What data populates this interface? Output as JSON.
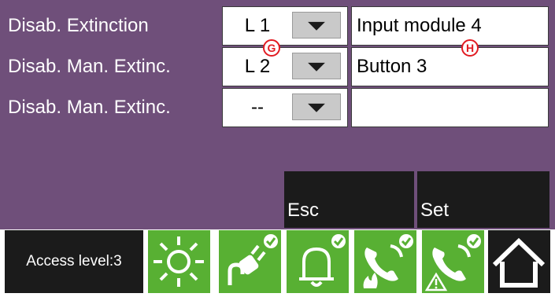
{
  "rows": [
    {
      "label": "Disab. Extinction",
      "level": "L 1",
      "device": "Input module 4"
    },
    {
      "label": "Disab. Man. Extinc.",
      "level": "L 2",
      "device": "Button 3"
    },
    {
      "label": "Disab. Man. Extinc.",
      "level": "--",
      "device": ""
    }
  ],
  "markers": {
    "g": "G",
    "h": "H"
  },
  "actions": {
    "esc": "Esc",
    "set": "Set"
  },
  "access_level": "Access level:3",
  "status_icons": [
    "sun-icon",
    "power-plug-icon",
    "bell-icon",
    "phone-fire-icon",
    "phone-warning-icon"
  ],
  "colors": {
    "panel": "#6f4f7a",
    "tile_green": "#58b033",
    "dark": "#1b1b1b",
    "marker_red": "#e21b22"
  }
}
